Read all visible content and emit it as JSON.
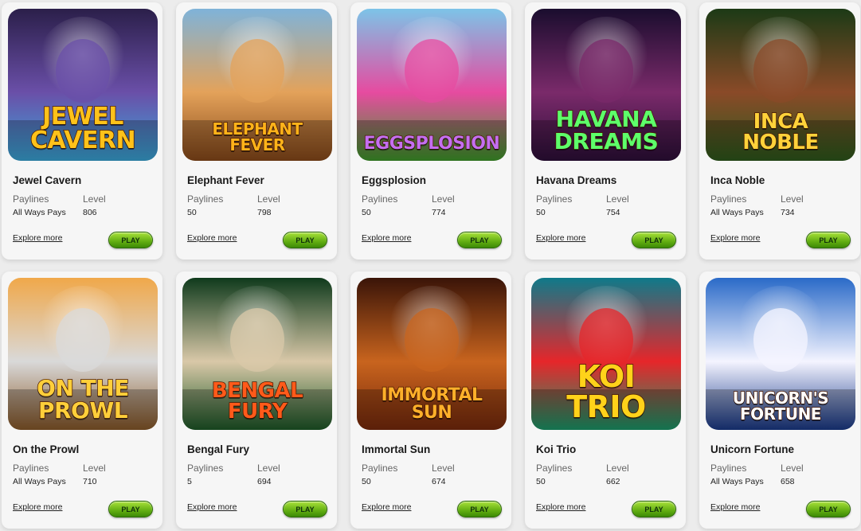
{
  "labels": {
    "paylines": "Paylines",
    "level": "Level",
    "explore": "Explore more",
    "play": "PLAY"
  },
  "games": [
    {
      "name": "Jewel Cavern",
      "art_title": [
        "JEWEL",
        "CAVERN"
      ],
      "paylines": "All Ways Pays",
      "level": "806",
      "colors": [
        "#2b1f4a",
        "#6a4fa8",
        "#3aa7d9"
      ],
      "title_color": "#ffc21a"
    },
    {
      "name": "Elephant Fever",
      "art_title": [
        "ELEPHANT",
        "FEVER"
      ],
      "paylines": "50",
      "level": "798",
      "colors": [
        "#7fb3d9",
        "#e3a25a",
        "#8a4a1a"
      ],
      "title_color": "#ffb31a"
    },
    {
      "name": "Eggsplosion",
      "art_title": [
        "EGGSPLOSION"
      ],
      "paylines": "50",
      "level": "774",
      "colors": [
        "#7cc4e8",
        "#e64ba0",
        "#3f9a2a"
      ],
      "title_color": "#c46ff0"
    },
    {
      "name": "Havana Dreams",
      "art_title": [
        "HAVANA",
        "DREAMS"
      ],
      "paylines": "50",
      "level": "754",
      "colors": [
        "#1a0d2e",
        "#7a2a6a",
        "#2e0f3a"
      ],
      "title_color": "#5dff6a"
    },
    {
      "name": "Inca Noble",
      "art_title": [
        "INCA",
        "NOBLE"
      ],
      "paylines": "All Ways Pays",
      "level": "734",
      "colors": [
        "#1c3a16",
        "#8a4a28",
        "#2e5a1c"
      ],
      "title_color": "#ffd23a"
    },
    {
      "name": "On the Prowl",
      "art_title": [
        "ON THE",
        "PROWL"
      ],
      "paylines": "All Ways Pays",
      "level": "710",
      "colors": [
        "#f0a84a",
        "#d9d9d9",
        "#8a5a2a"
      ],
      "title_color": "#ffcf3a"
    },
    {
      "name": "Bengal Fury",
      "art_title": [
        "BENGAL",
        "FURY"
      ],
      "paylines": "5",
      "level": "694",
      "colors": [
        "#0f3a1c",
        "#d9c8a8",
        "#1e5a28"
      ],
      "title_color": "#ff5a1a"
    },
    {
      "name": "Immortal Sun",
      "art_title": [
        "IMMORTAL",
        "SUN"
      ],
      "paylines": "50",
      "level": "674",
      "colors": [
        "#3a1408",
        "#c8641e",
        "#7a2a0c"
      ],
      "title_color": "#ffb02a"
    },
    {
      "name": "Koi Trio",
      "art_title": [
        "KOI",
        "TRIO"
      ],
      "paylines": "50",
      "level": "662",
      "colors": [
        "#0f7a8a",
        "#e6262a",
        "#1a9a6a"
      ],
      "title_color": "#ffd21a"
    },
    {
      "name": "Unicorn Fortune",
      "art_title": [
        "UNICORN'S",
        "FORTUNE"
      ],
      "paylines": "All Ways Pays",
      "level": "658",
      "colors": [
        "#2a6ac8",
        "#f4f4ff",
        "#1a3a8a"
      ],
      "title_color": "#ffffff"
    }
  ]
}
